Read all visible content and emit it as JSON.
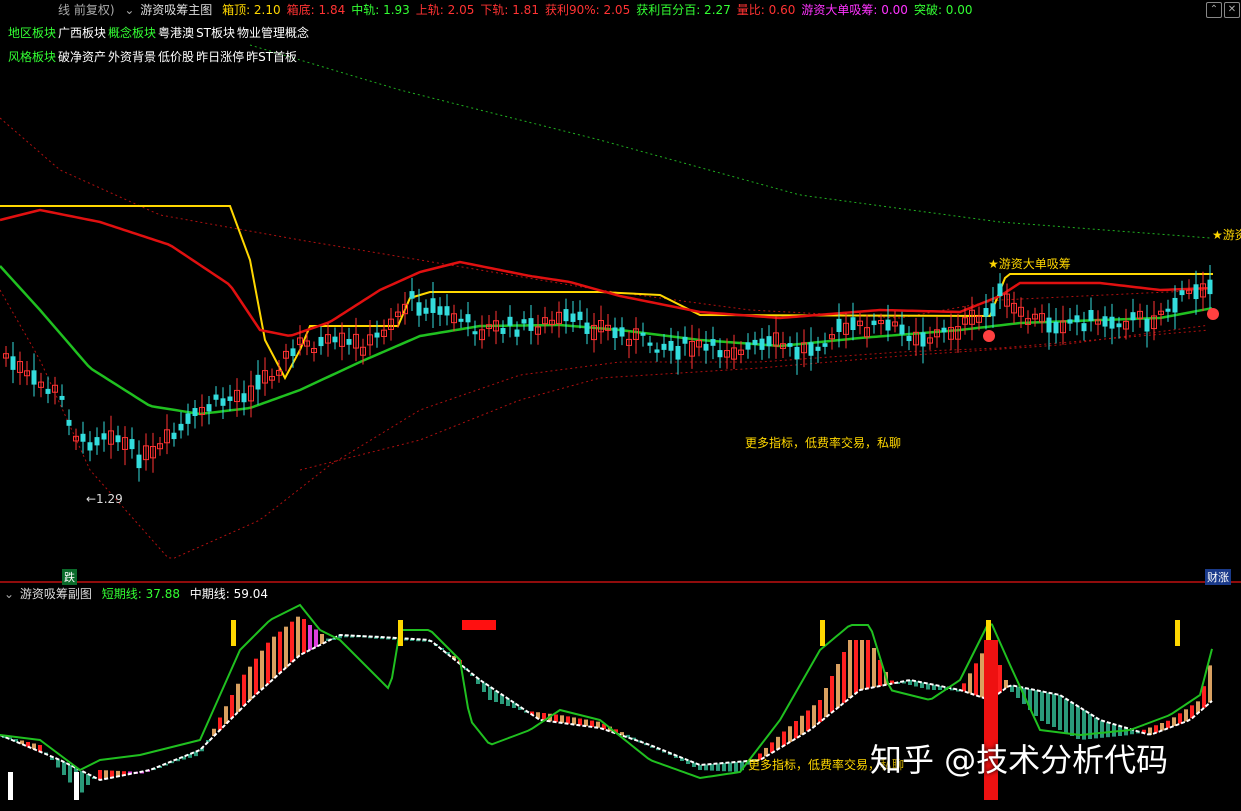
{
  "main_header": {
    "prefix": "线 前复权)",
    "title": "游资吸筹主图",
    "items": [
      {
        "label": "箱顶:",
        "value": "2.10",
        "color": "#ffd700"
      },
      {
        "label": "箱底:",
        "value": "1.84",
        "color": "#ff3333"
      },
      {
        "label": "中轨:",
        "value": "1.93",
        "color": "#33ff33"
      },
      {
        "label": "上轨:",
        "value": "2.05",
        "color": "#ff3333"
      },
      {
        "label": "下轨:",
        "value": "1.81",
        "color": "#ff3333"
      },
      {
        "label": "获利90%:",
        "value": "2.05",
        "color": "#ff3333"
      },
      {
        "label": "获利百分百:",
        "value": "2.27",
        "color": "#33ff33"
      },
      {
        "label": "量比:",
        "value": "0.60",
        "color": "#ff3333"
      },
      {
        "label": "游资大单吸筹:",
        "value": "0.00",
        "color": "#ff33ff"
      },
      {
        "label": "突破:",
        "value": "0.00",
        "color": "#33ff33"
      }
    ]
  },
  "tags_row1": [
    {
      "text": "地区板块",
      "color": "#33ff33"
    },
    {
      "text": "广西板块",
      "color": "#ffffff"
    },
    {
      "text": "概念板块",
      "color": "#33ff33"
    },
    {
      "text": "粤港澳",
      "color": "#ffffff"
    },
    {
      "text": "ST板块",
      "color": "#ffffff"
    },
    {
      "text": "物业管理概念",
      "color": "#ffffff"
    }
  ],
  "tags_row2": [
    {
      "text": "风格板块",
      "color": "#33ff33"
    },
    {
      "text": "破净资产",
      "color": "#ffffff"
    },
    {
      "text": "外资背景",
      "color": "#ffffff"
    },
    {
      "text": "低价股",
      "color": "#ffffff"
    },
    {
      "text": "昨日涨停",
      "color": "#ffffff"
    },
    {
      "text": "昨ST首板",
      "color": "#ffffff"
    }
  ],
  "annotations": {
    "signal_top_right": "★游资",
    "signal_mid": "★游资大单吸筹",
    "low_price": "←1.29",
    "ad_text": "更多指标，低费率交易，私聊",
    "ad_text_sub": "更多指标，低费率交易，私聊",
    "marker_fall": "跌",
    "marker_finance": "财涨"
  },
  "sub_header": {
    "title": "游资吸筹副图",
    "short_label": "短期线:",
    "short_value": "37.88",
    "mid_label": "中期线:",
    "mid_value": "59.04"
  },
  "watermark": "知乎 @技术分析代码",
  "colors": {
    "up": "#ff3333",
    "down": "#33dddd",
    "box_top": "#ffd700",
    "red_line": "#e01010",
    "green_line": "#20c020"
  },
  "chart_data": {
    "type": "line",
    "title": "游资吸筹主图",
    "series": [
      {
        "name": "箱顶",
        "values": [
          2.1
        ]
      },
      {
        "name": "箱底",
        "values": [
          1.84
        ]
      },
      {
        "name": "中轨",
        "values": [
          1.93
        ]
      },
      {
        "name": "上轨",
        "values": [
          2.05
        ]
      },
      {
        "name": "下轨",
        "values": [
          1.81
        ]
      }
    ],
    "min_price_label": "1.29",
    "indicator": {
      "title": "游资吸筹副图",
      "short_line": 37.88,
      "mid_line": 59.04
    }
  }
}
